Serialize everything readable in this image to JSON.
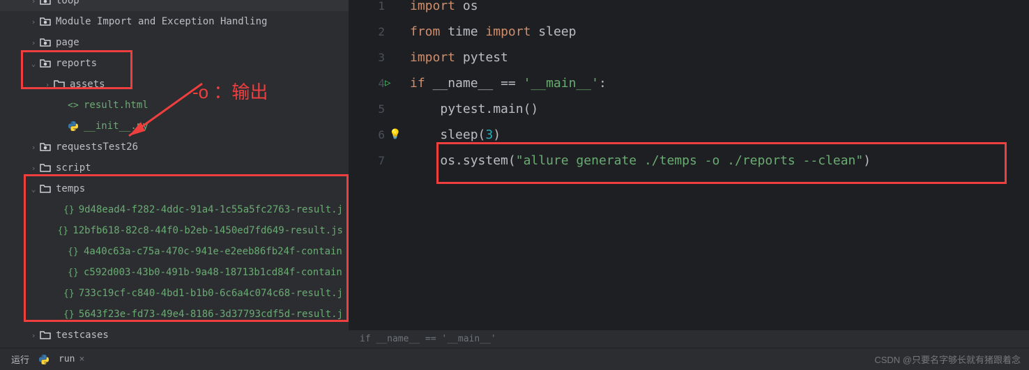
{
  "sidebar": {
    "items": [
      {
        "indent": 1,
        "chevron": "right",
        "icon": "folder-dot",
        "label": "loop",
        "cls": "file-regular"
      },
      {
        "indent": 1,
        "chevron": "right",
        "icon": "folder-dot",
        "label": "Module Import and Exception Handling",
        "cls": "file-regular"
      },
      {
        "indent": 1,
        "chevron": "right",
        "icon": "folder-dot",
        "label": "page",
        "cls": "file-regular"
      },
      {
        "indent": 1,
        "chevron": "down",
        "icon": "folder-dot",
        "label": "reports",
        "cls": "file-regular"
      },
      {
        "indent": 2,
        "chevron": "right",
        "icon": "folder",
        "label": "assets",
        "cls": "file-regular"
      },
      {
        "indent": 3,
        "chevron": "",
        "icon": "html",
        "label": "result.html",
        "cls": "file-green"
      },
      {
        "indent": 3,
        "chevron": "",
        "icon": "python",
        "label": "__init__.py",
        "cls": "file-green"
      },
      {
        "indent": 1,
        "chevron": "right",
        "icon": "folder-dot",
        "label": "requestsTest26",
        "cls": "file-regular"
      },
      {
        "indent": 1,
        "chevron": "right",
        "icon": "folder",
        "label": "script",
        "cls": "file-regular"
      },
      {
        "indent": 1,
        "chevron": "down",
        "icon": "folder",
        "label": "temps",
        "cls": "file-regular"
      },
      {
        "indent": 3,
        "chevron": "",
        "icon": "json",
        "label": "9d48ead4-f282-4ddc-91a4-1c55a5fc2763-result.j",
        "cls": "file-green"
      },
      {
        "indent": 3,
        "chevron": "",
        "icon": "json",
        "label": "12bfb618-82c8-44f0-b2eb-1450ed7fd649-result.js",
        "cls": "file-green"
      },
      {
        "indent": 3,
        "chevron": "",
        "icon": "json",
        "label": "4a40c63a-c75a-470c-941e-e2eeb86fb24f-contain",
        "cls": "file-green"
      },
      {
        "indent": 3,
        "chevron": "",
        "icon": "json",
        "label": "c592d003-43b0-491b-9a48-18713b1cd84f-contain",
        "cls": "file-green"
      },
      {
        "indent": 3,
        "chevron": "",
        "icon": "json",
        "label": "733c19cf-c840-4bd1-b1b0-6c6a4c074c68-result.j",
        "cls": "file-green"
      },
      {
        "indent": 3,
        "chevron": "",
        "icon": "json",
        "label": "5643f23e-fd73-49e4-8186-3d37793cdf5d-result.j",
        "cls": "file-green"
      },
      {
        "indent": 1,
        "chevron": "right",
        "icon": "folder",
        "label": "testcases",
        "cls": "file-regular"
      }
    ]
  },
  "editor": {
    "lines": [
      {
        "n": "1",
        "html": "<span class='kw'>import</span> <span class='plain'>os</span>"
      },
      {
        "n": "2",
        "html": "<span class='kw'>from</span> <span class='plain'>time</span> <span class='kw'>import</span> <span class='plain'>sleep</span>"
      },
      {
        "n": "3",
        "html": "<span class='kw'>import</span> <span class='plain'>pytest</span>"
      },
      {
        "n": "4",
        "html": "<span class='kw'>if</span> <span class='plain'>__name__ == </span><span class='str'>'__main__'</span><span class='plain'>:</span>",
        "run": true
      },
      {
        "n": "5",
        "html": "    <span class='plain'>pytest.main()</span>"
      },
      {
        "n": "6",
        "html": "    <span class='plain'>sleep(</span><span class='num'>3</span><span class='plain'>)</span>",
        "bulb": true
      },
      {
        "n": "7",
        "html": "    <span class='plain'>os.system(</span><span class='str'>\"allure generate ./temps -o ./reports --clean\"</span><span class='plain'>)</span>"
      }
    ],
    "breadcrumb": "if __name__ == '__main__'"
  },
  "bottom": {
    "run_label": "运行",
    "tab_label": "run"
  },
  "annotations": {
    "output_label": "-o ：输出"
  },
  "watermark": "CSDN @只要名字够长就有猪跟着念"
}
